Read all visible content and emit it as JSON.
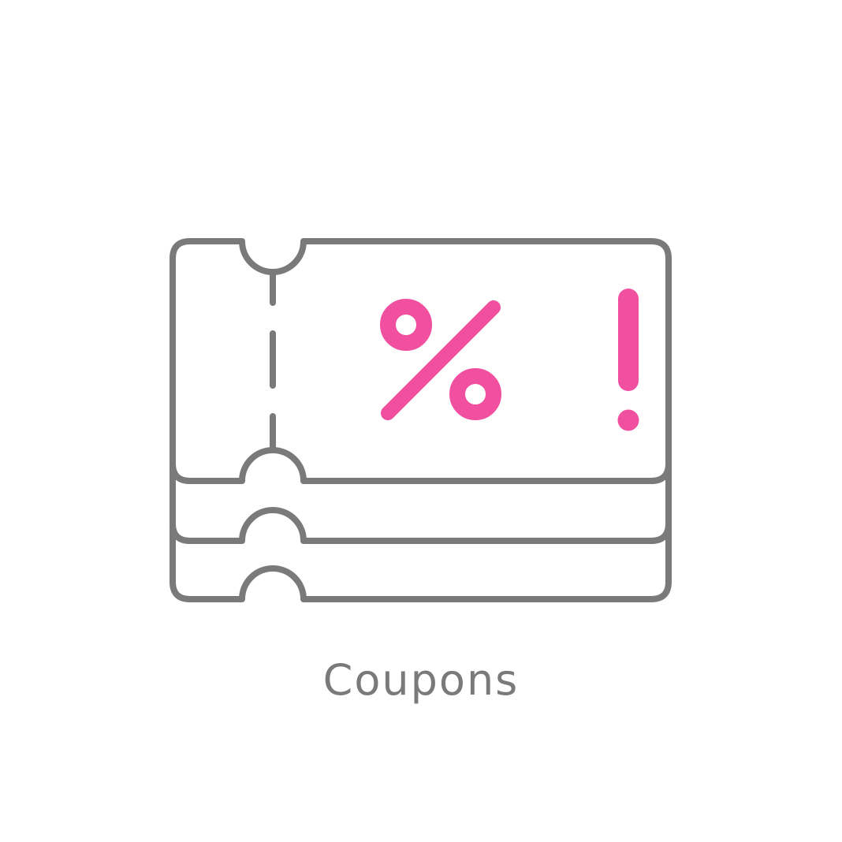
{
  "icon": {
    "name": "coupons-icon",
    "stroke_color": "#7a7a7a",
    "accent_color": "#f14fa0"
  },
  "caption": {
    "label": "Coupons"
  }
}
